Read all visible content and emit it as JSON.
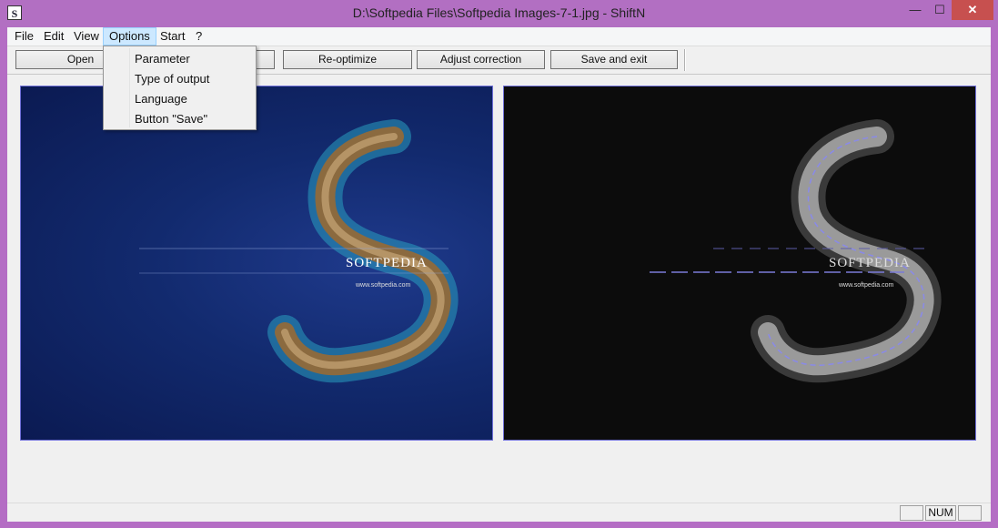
{
  "window": {
    "title": "D:\\Softpedia Files\\Softpedia Images-7-1.jpg - ShiftN",
    "icon_letter": "S",
    "controls": {
      "minimize": "—",
      "maximize": "☐",
      "close": "✕"
    }
  },
  "menubar": {
    "items": [
      {
        "label": "File"
      },
      {
        "label": "Edit"
      },
      {
        "label": "View"
      },
      {
        "label": "Options",
        "active": true
      },
      {
        "label": "Start"
      },
      {
        "label": "?"
      }
    ]
  },
  "options_menu": {
    "items": [
      {
        "label": "Parameter"
      },
      {
        "label": "Type of output"
      },
      {
        "label": "Language"
      },
      {
        "label": "Button \"Save\""
      }
    ]
  },
  "toolbar": {
    "open_label": "Open",
    "reoptimize_label": "Re-optimize",
    "adjust_label": "Adjust correction",
    "save_exit_label": "Save and exit"
  },
  "images": {
    "original": {
      "brand": "SOFTPEDIA",
      "url": "www.softpedia.com"
    },
    "result": {
      "brand": "SOFTPEDIA",
      "url": "www.softpedia.com"
    }
  },
  "statusbar": {
    "panes": [
      "",
      "NUM",
      ""
    ]
  },
  "colors": {
    "titlebar": "#b26fc2",
    "close_button": "#c7504f",
    "menu_highlight": "#cce8ff",
    "image_border": "#6f6fd8"
  }
}
